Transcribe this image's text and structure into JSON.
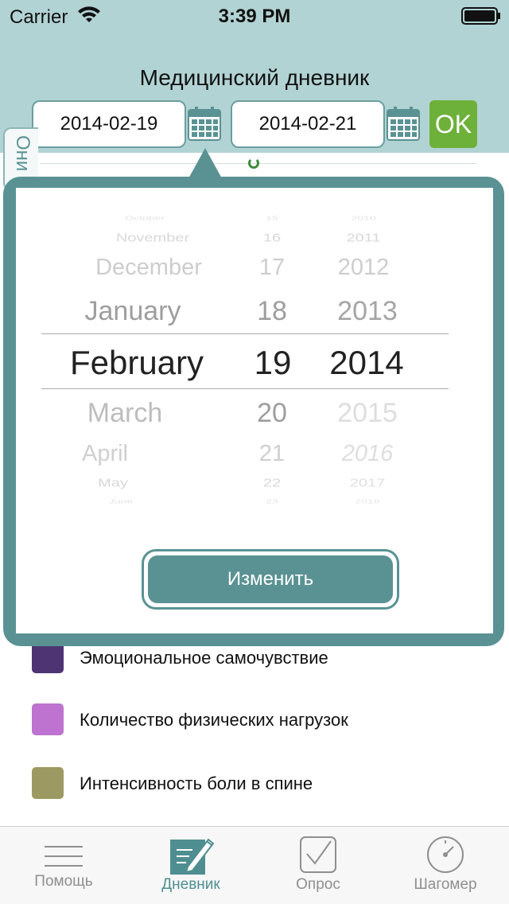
{
  "status_bar": {
    "carrier": "Carrier",
    "time": "3:39 PM"
  },
  "header": {
    "title": "Медицинский дневник",
    "start_date": "2014-02-19",
    "end_date": "2014-02-21",
    "ok_label": "OK",
    "side_tab_label": "Они"
  },
  "picker": {
    "months": [
      "October",
      "November",
      "December",
      "January",
      "February",
      "March",
      "April",
      "May",
      "June"
    ],
    "days": [
      "15",
      "16",
      "17",
      "18",
      "19",
      "20",
      "21",
      "22",
      "23"
    ],
    "years": [
      "2010",
      "2011",
      "2012",
      "2013",
      "2014",
      "2015",
      "2016",
      "2017",
      "2018"
    ],
    "selected": {
      "month": "February",
      "day": "19",
      "year": "2014"
    },
    "change_label": "Изменить"
  },
  "legend": [
    {
      "label": "Эмоциональное самочувствие",
      "color": "#4e3473"
    },
    {
      "label": "Количество физических нагрузок",
      "color": "#bd73cf"
    },
    {
      "label": "Интенсивность боли в спине",
      "color": "#9c9a62"
    }
  ],
  "tabs": [
    {
      "label": "Помощь",
      "icon": "menu-lines-icon"
    },
    {
      "label": "Дневник",
      "icon": "notebook-pen-icon",
      "active": true
    },
    {
      "label": "Опрос",
      "icon": "checkbox-icon"
    },
    {
      "label": "Шагомер",
      "icon": "gauge-icon"
    }
  ],
  "colors": {
    "accent": "#5a9294",
    "ok": "#6db03a",
    "background": "#b2d3d4"
  }
}
